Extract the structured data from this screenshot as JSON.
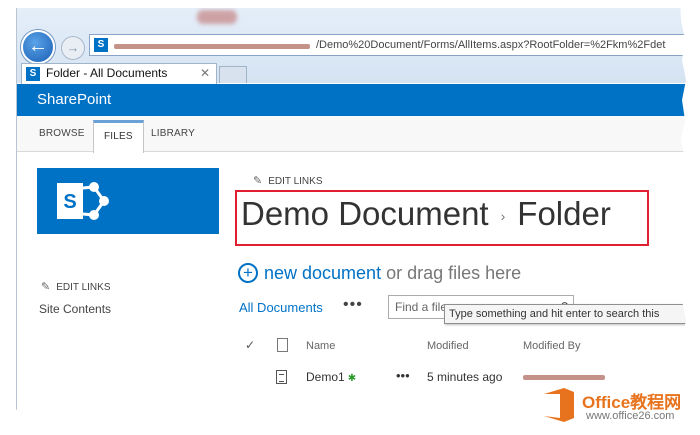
{
  "browser": {
    "url_visible": "/Demo%20Document/Forms/AllItems.aspx?RootFolder=%2Fkm%2Fdet",
    "tab_title": "Folder - All Documents",
    "tab_close": "✕",
    "back_glyph": "←",
    "forward_glyph": "→"
  },
  "suite_bar": {
    "title": "SharePoint"
  },
  "ribbon": {
    "tabs": [
      "BROWSE",
      "FILES",
      "LIBRARY"
    ],
    "active_tab": "FILES"
  },
  "left_nav": {
    "edit_links": "EDIT LINKS",
    "site_contents": "Site Contents"
  },
  "header": {
    "edit_links": "EDIT LINKS",
    "breadcrumb": [
      "Demo Document",
      "Folder"
    ],
    "breadcrumb_separator": "›"
  },
  "commands": {
    "new_document": "new document",
    "drag_text": "or drag files here",
    "view_name": "All Documents",
    "more": "•••",
    "search_placeholder": "Find a file",
    "search_tooltip": "Type something and hit enter to search this"
  },
  "list": {
    "columns": [
      "Name",
      "Modified",
      "Modified By"
    ],
    "rows": [
      {
        "name": "Demo1",
        "new_marker": "✱",
        "menu": "•••",
        "modified": "5 minutes ago",
        "modified_by_redacted": true
      }
    ]
  },
  "watermark": {
    "brand": "Office教程网",
    "sub": "www.office26.com"
  },
  "colors": {
    "accent": "#0072c6",
    "highlight_box": "#e02030",
    "watermark": "#e8731e"
  },
  "icons": [
    "back-arrow-icon",
    "forward-arrow-icon",
    "sharepoint-favicon-icon",
    "pencil-icon",
    "plus-circle-icon",
    "search-icon",
    "checkmark-icon",
    "document-icon"
  ]
}
